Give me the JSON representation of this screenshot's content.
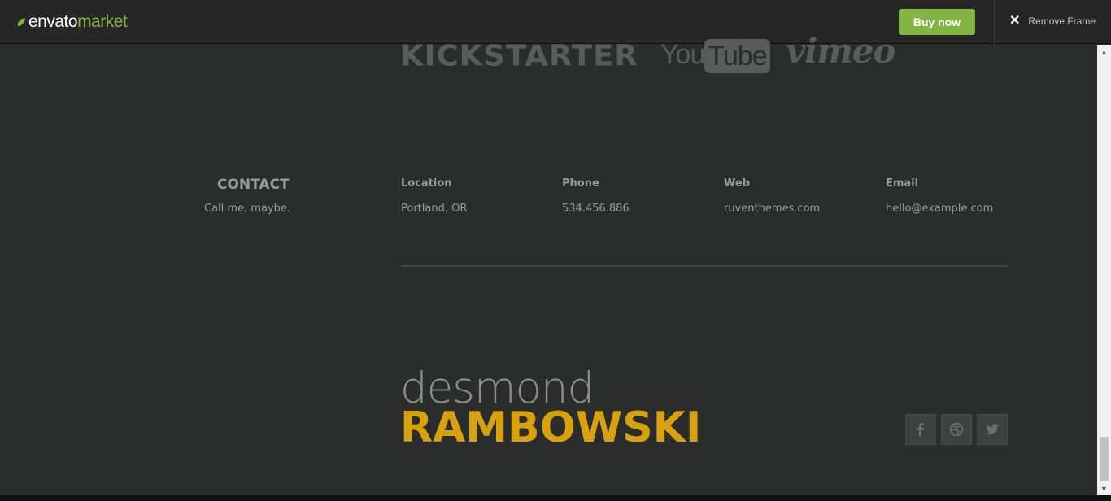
{
  "topbar": {
    "brand_primary": "envato",
    "brand_secondary": "market",
    "buy_label": "Buy now",
    "remove_frame_label": "Remove Frame",
    "accent": "#82b541"
  },
  "logos": {
    "kickstarter": "KICKSTARTER",
    "youtube_you": "You",
    "youtube_tube": "Tube",
    "vimeo": "vimeo"
  },
  "contact": {
    "title": "CONTACT",
    "subtitle": "Call me, maybe.",
    "columns": [
      {
        "label": "Location",
        "value": "Portland, OR"
      },
      {
        "label": "Phone",
        "value": "534.456.886"
      },
      {
        "label": "Web",
        "value": "ruventhemes.com"
      },
      {
        "label": "Email",
        "value": "hello@example.com"
      }
    ]
  },
  "signature": {
    "first": "desmond",
    "last": "RAMBOWSKI",
    "accent": "#d8a20e"
  },
  "social": [
    {
      "icon": "facebook-icon"
    },
    {
      "icon": "dribbble-icon"
    },
    {
      "icon": "twitter-icon"
    }
  ]
}
